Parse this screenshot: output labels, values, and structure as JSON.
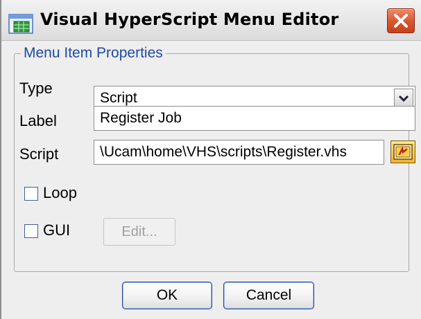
{
  "window": {
    "title": "Visual HyperScript Menu Editor",
    "app_icon": "app-grid-icon",
    "close_icon": "close-x-icon"
  },
  "group": {
    "legend": "Menu Item Properties"
  },
  "fields": {
    "type_label": "Type",
    "type_value": "Script",
    "label_label": "Label",
    "label_value": "Register Job",
    "script_label": "Script",
    "script_value": "\\Ucam\\home\\VHS\\scripts\\Register.vhs",
    "browse_icon": "folder-browse-icon"
  },
  "options": {
    "loop_label": "Loop",
    "loop_checked": false,
    "gui_label": "GUI",
    "gui_checked": false,
    "edit_label": "Edit..."
  },
  "buttons": {
    "ok_label": "OK",
    "cancel_label": "Cancel"
  },
  "colors": {
    "legend": "#1f49a8",
    "close_button": "#d9532c"
  }
}
